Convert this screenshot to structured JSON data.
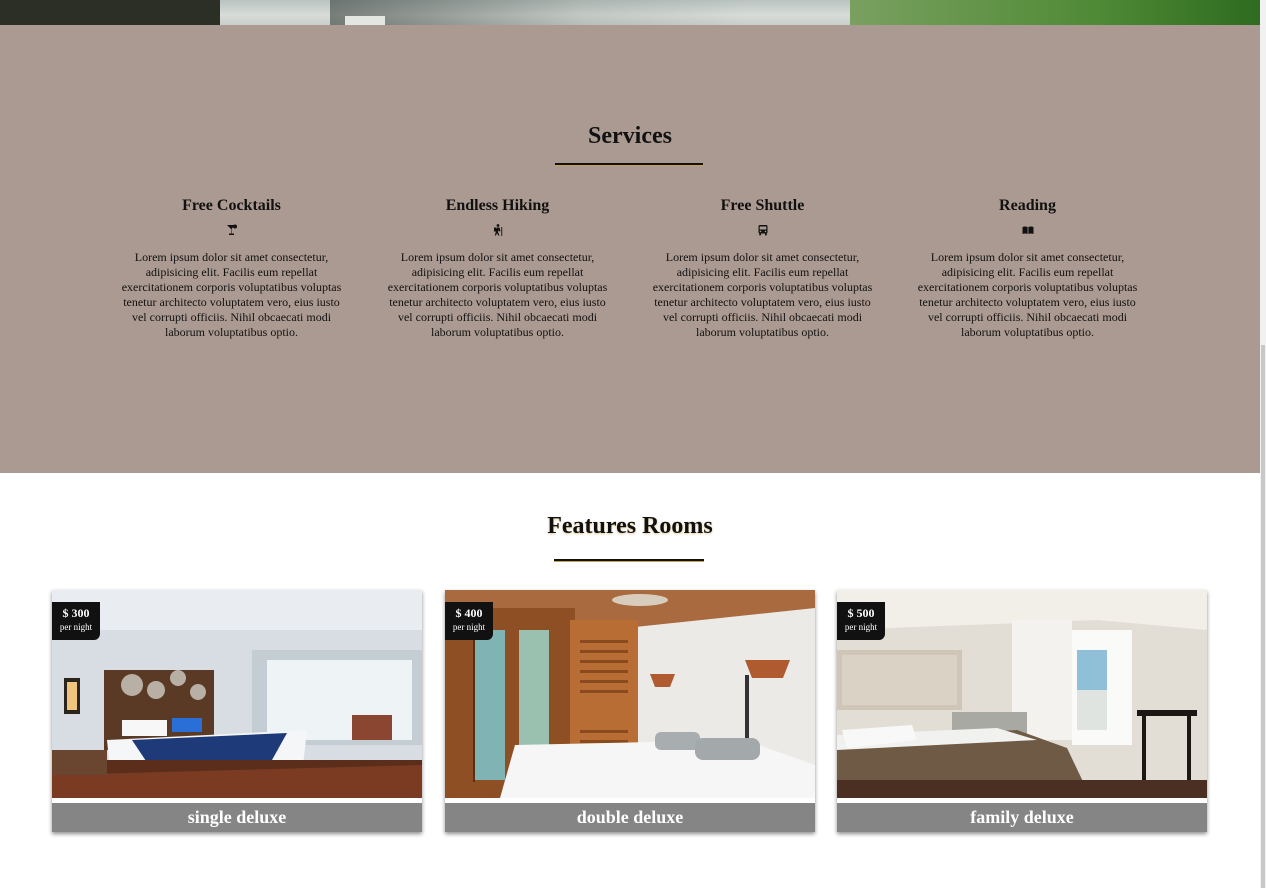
{
  "services": {
    "title": "Services",
    "items": [
      {
        "title": "Free Cocktails",
        "icon": "cocktail-icon",
        "text": "Lorem ipsum dolor sit amet consectetur, adipisicing elit. Facilis eum repellat exercitationem corporis voluptatibus voluptas tenetur architecto voluptatem vero, eius iusto vel corrupti officiis. Nihil obcaecati modi laborum voluptatibus optio."
      },
      {
        "title": "Endless Hiking",
        "icon": "hiking-icon",
        "text": "Lorem ipsum dolor sit amet consectetur, adipisicing elit. Facilis eum repellat exercitationem corporis voluptatibus voluptas tenetur architecto voluptatem vero, eius iusto vel corrupti officiis. Nihil obcaecati modi laborum voluptatibus optio."
      },
      {
        "title": "Free Shuttle",
        "icon": "shuttle-icon",
        "text": "Lorem ipsum dolor sit amet consectetur, adipisicing elit. Facilis eum repellat exercitationem corporis voluptatibus voluptas tenetur architecto voluptatem vero, eius iusto vel corrupti officiis. Nihil obcaecati modi laborum voluptatibus optio."
      },
      {
        "title": "Reading",
        "icon": "book-icon",
        "text": "Lorem ipsum dolor sit amet consectetur, adipisicing elit. Facilis eum repellat exercitationem corporis voluptatibus voluptas tenetur architecto voluptatem vero, eius iusto vel corrupti officiis. Nihil obcaecati modi laborum voluptatibus optio."
      }
    ]
  },
  "rooms": {
    "title": "Features Rooms",
    "items": [
      {
        "name": "single deluxe",
        "price": "$ 300",
        "per": "per night"
      },
      {
        "name": "double deluxe",
        "price": "$ 400",
        "per": "per night"
      },
      {
        "name": "family deluxe",
        "price": "$ 500",
        "per": "per night"
      }
    ]
  },
  "colors": {
    "services_bg": "#ab9a91",
    "accent": "#c9a24a",
    "room_label_bg": "#858585",
    "price_tag_bg": "#111111"
  }
}
